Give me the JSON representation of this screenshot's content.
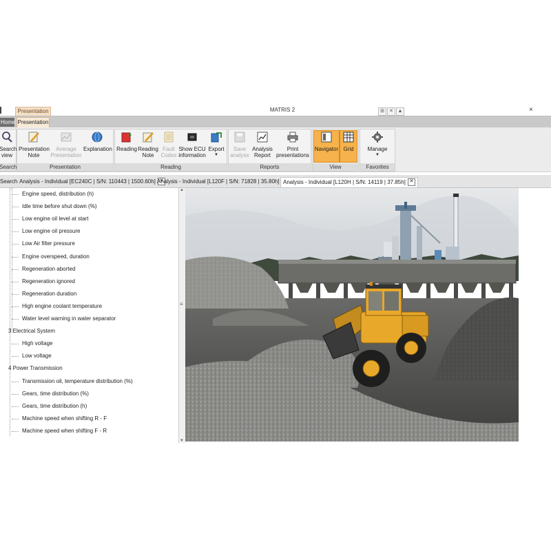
{
  "window": {
    "title": "MATRIS 2",
    "context_tab": "Presentation",
    "title_controls": [
      "⊞",
      "✕",
      "▲"
    ],
    "close_glyph": "×"
  },
  "ribbon_tabs": {
    "home": "Home",
    "presentation": "Presentation"
  },
  "ribbon": {
    "search_group": {
      "label": "Search",
      "button": "Search\nview"
    },
    "presentation_group": {
      "label": "Presentation",
      "buttons": [
        "Presentation\nNote",
        "Average\nPresentation",
        "Explanation"
      ]
    },
    "reading_group": {
      "label": "Reading",
      "buttons": [
        "Reading",
        "Reading\nNote",
        "Fault\nCodes",
        "Show ECU\ninformation",
        "Export"
      ]
    },
    "reports_group": {
      "label": "Reports",
      "buttons": [
        "Save\nanalyse",
        "Analysis\nReport",
        "Print\npresentations"
      ]
    },
    "view_group": {
      "label": "View",
      "buttons": [
        "Navigator",
        "Grid"
      ]
    },
    "favorites_group": {
      "label": "Favorites",
      "buttons": [
        "Manage"
      ]
    }
  },
  "doc_tabs": {
    "search": "Search",
    "tabs": [
      "Analysis - Individual [EC240C | S/N: 110443 | 1500.60h]",
      "Analysis - Individual [L120F | S/N: 71828 | 35.80h]",
      "Analysis - Individual [L120H | S/N: 14119 | 37.85h]"
    ],
    "close_glyph": "✕"
  },
  "tree": {
    "items_top": [
      "Engine speed, distribution (h)",
      "Idle time before shut down (%)",
      "Low engine oil level at start",
      "Low engine oil pressure",
      "Low Air filter pressure",
      "Engine overspeed, duration",
      "Regeneration aborted",
      "Regeneration ignored",
      "Regeneration duration",
      "High engine coolant temperature",
      "Water level warning in water separator"
    ],
    "cat3": "3 Electrical System",
    "items_cat3": [
      "High voltage",
      "Low voltage"
    ],
    "cat4": "4 Power Transmission",
    "items_cat4": [
      "Transmission oil, temperature distribution (%)",
      "Gears, time distribution (%)",
      "Gears, time distribution (h)",
      "Machine speed when shifting R - F",
      "Machine speed when shifting F - R"
    ]
  },
  "colors": {
    "accent_orange": "#f6b24c",
    "loader_yellow": "#e8a82a",
    "ribbon_bg": "#ececec"
  }
}
